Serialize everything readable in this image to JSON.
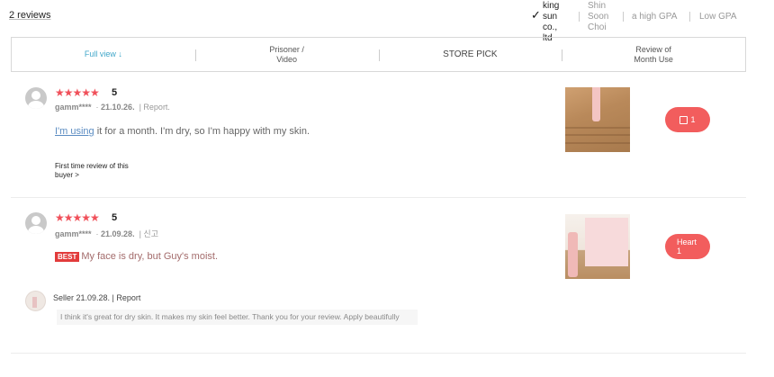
{
  "header": {
    "review_count": "2 reviews",
    "sort_options": [
      {
        "label_lines": [
          "king",
          "sun",
          "co.,",
          "ltd"
        ],
        "selected": true
      },
      {
        "label_lines": [
          "Shin",
          "Soon",
          "Choi"
        ],
        "selected": false
      },
      {
        "label_lines": [
          "a high GPA"
        ],
        "selected": false
      },
      {
        "label_lines": [
          "Low GPA"
        ],
        "selected": false
      }
    ]
  },
  "filters": [
    {
      "lines": [
        "Full view ↓"
      ],
      "active": true
    },
    {
      "lines": [
        "Prisoner /",
        "Video"
      ],
      "active": false
    },
    {
      "lines": [
        "STORE PICK"
      ],
      "active": false
    },
    {
      "lines": [
        "Review of",
        "Month Use"
      ],
      "active": false
    }
  ],
  "reviews": [
    {
      "stars": "★★★★★",
      "score": "5",
      "user": "gamm****",
      "date": "21.10.26.",
      "report": "Report.",
      "text_highlight": "I'm using",
      "text_rest": " it for a month. I'm dry, so I'm happy with my skin.",
      "first_review_line1": "First time review of this",
      "first_review_line2": "buyer >",
      "like_label": "1"
    },
    {
      "stars": "★★★★★",
      "score": "5",
      "user": "gamm****",
      "date": "21.09.28.",
      "report": "신고",
      "best_badge": "BEST",
      "text": "My face is dry, but Guy's moist.",
      "like_line1": "Heart",
      "like_line2": "1",
      "seller": {
        "meta": "Seller 21.09.28. | Report",
        "reply": "I think it's great for dry skin. It makes my skin feel better. Thank you for your review. Apply beautifully"
      }
    }
  ],
  "colors": {
    "star": "#f0505a",
    "like_button": "#f25d5d",
    "active_filter": "#3fa6c9",
    "best_badge": "#e23b3b"
  }
}
